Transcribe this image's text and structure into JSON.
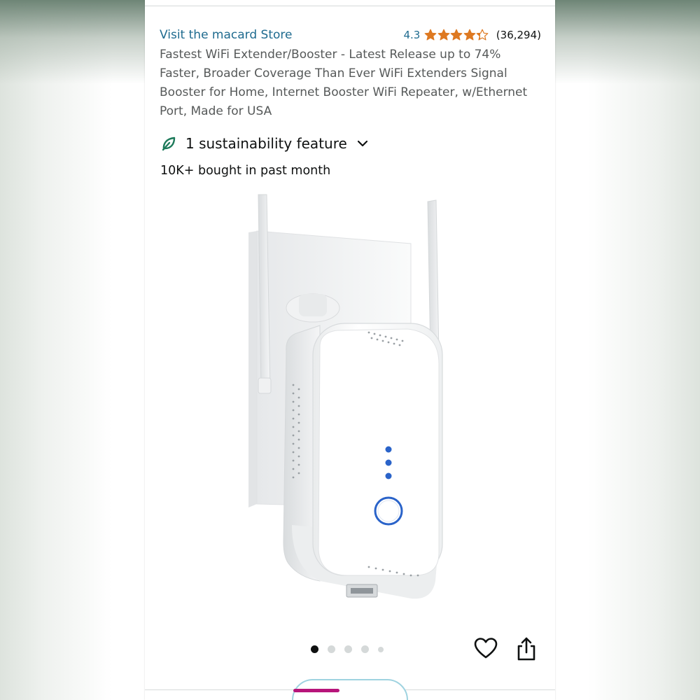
{
  "store": {
    "link_text": "Visit the macard Store",
    "rating": "4.3",
    "stars_filled": 4.3,
    "stars_total": 5,
    "review_count": "(36,294)",
    "star_color": "#de7921",
    "link_color": "#1f6b8f"
  },
  "product": {
    "title": "Fastest WiFi Extender/Booster - Latest Release up to 74% Faster, Broader Coverage Than Ever WiFi Extenders Signal Booster for Home, Internet Booster WiFi Repeater, w/Ethernet Port, Made for USA",
    "sustainability_label": "1 sustainability feature",
    "sustainability_icon": "leaf-icon",
    "sustainability_color": "#1d7a5a",
    "bought_text": "10K+ bought in past month"
  },
  "gallery": {
    "image_count": 5,
    "active_index": 0,
    "icons": [
      "heart-icon",
      "share-icon"
    ]
  },
  "bottom_bar": {
    "accent": "#b7157a"
  }
}
